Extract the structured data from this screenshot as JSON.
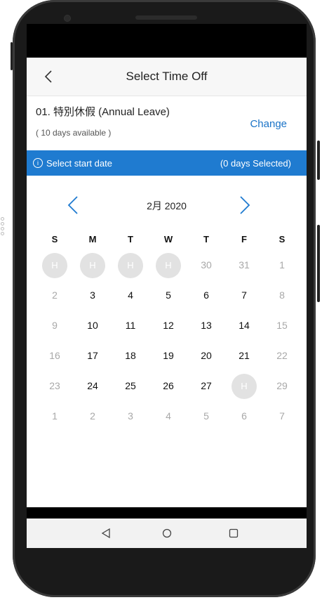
{
  "header": {
    "title": "Select Time Off"
  },
  "leave": {
    "name": "01. 特別休假 (Annual Leave)",
    "available": "( 10 days available )",
    "change_label": "Change"
  },
  "info": {
    "hint": "Select start date",
    "selected": "(0 days Selected)",
    "icon": "i"
  },
  "calendar": {
    "month_label": "2月 2020",
    "days_of_week": [
      "S",
      "M",
      "T",
      "W",
      "T",
      "F",
      "S"
    ],
    "weeks": [
      [
        {
          "t": "H",
          "s": "holiday"
        },
        {
          "t": "H",
          "s": "holiday"
        },
        {
          "t": "H",
          "s": "holiday"
        },
        {
          "t": "H",
          "s": "holiday"
        },
        {
          "t": "30",
          "s": "muted"
        },
        {
          "t": "31",
          "s": "muted"
        },
        {
          "t": "1",
          "s": "muted"
        }
      ],
      [
        {
          "t": "2",
          "s": "muted"
        },
        {
          "t": "3",
          "s": "normal"
        },
        {
          "t": "4",
          "s": "normal"
        },
        {
          "t": "5",
          "s": "normal"
        },
        {
          "t": "6",
          "s": "normal"
        },
        {
          "t": "7",
          "s": "normal"
        },
        {
          "t": "8",
          "s": "muted"
        }
      ],
      [
        {
          "t": "9",
          "s": "muted"
        },
        {
          "t": "10",
          "s": "normal"
        },
        {
          "t": "11",
          "s": "normal"
        },
        {
          "t": "12",
          "s": "normal"
        },
        {
          "t": "13",
          "s": "normal"
        },
        {
          "t": "14",
          "s": "normal"
        },
        {
          "t": "15",
          "s": "muted"
        }
      ],
      [
        {
          "t": "16",
          "s": "muted"
        },
        {
          "t": "17",
          "s": "normal"
        },
        {
          "t": "18",
          "s": "normal"
        },
        {
          "t": "19",
          "s": "normal"
        },
        {
          "t": "20",
          "s": "normal"
        },
        {
          "t": "21",
          "s": "normal"
        },
        {
          "t": "22",
          "s": "muted"
        }
      ],
      [
        {
          "t": "23",
          "s": "muted"
        },
        {
          "t": "24",
          "s": "normal"
        },
        {
          "t": "25",
          "s": "normal"
        },
        {
          "t": "26",
          "s": "normal"
        },
        {
          "t": "27",
          "s": "normal"
        },
        {
          "t": "H",
          "s": "holiday"
        },
        {
          "t": "29",
          "s": "muted"
        }
      ],
      [
        {
          "t": "1",
          "s": "muted"
        },
        {
          "t": "2",
          "s": "muted"
        },
        {
          "t": "3",
          "s": "muted"
        },
        {
          "t": "4",
          "s": "muted"
        },
        {
          "t": "5",
          "s": "muted"
        },
        {
          "t": "6",
          "s": "muted"
        },
        {
          "t": "7",
          "s": "muted"
        }
      ]
    ]
  },
  "icons": {
    "back": "chevron-left-icon",
    "prev": "chevron-left-icon",
    "next": "chevron-right-icon",
    "sys_back": "triangle-back-icon",
    "sys_home": "circle-home-icon",
    "sys_recent": "square-recents-icon"
  },
  "colors": {
    "accent": "#1f7bd0",
    "holiday": "#e2e2e2",
    "muted": "#a8a8a8"
  }
}
